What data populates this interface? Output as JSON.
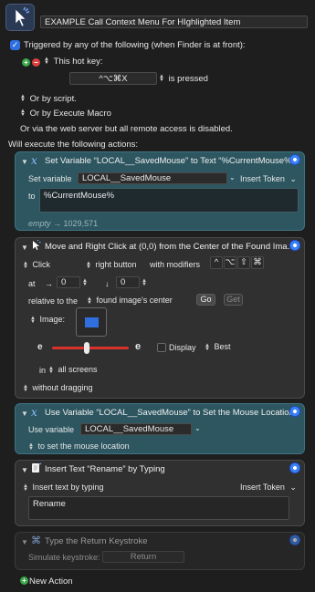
{
  "header": {
    "macro_name": "EXAMPLE Call Context Menu For HIghlighted Item"
  },
  "trigger": {
    "checkbox_label": "Triggered by any of the following (when Finder is at front):",
    "hotkey_label": "This hot key:",
    "hotkey_value": "^⌥⌘X",
    "hotkey_state": "is pressed",
    "or_by_script": "Or by script.",
    "or_by_execute_macro": "Or by Execute Macro",
    "web_server_note": "Or via the web server but all remote access is disabled."
  },
  "actions_header": "Will execute the following actions:",
  "action1": {
    "title": "Set Variable “LOCAL__SavedMouse” to Text “%CurrentMouse%”",
    "set_variable_label": "Set variable",
    "variable_name": "LOCAL__SavedMouse",
    "insert_token": "Insert Token",
    "to_label": "to",
    "text_value": "%CurrentMouse%",
    "result_empty": "empty",
    "result_value": "1029,571"
  },
  "action2": {
    "title": "Move and Right Click at (0,0) from the Center of the Found Ima...",
    "click_label": "Click",
    "button_label": "right button",
    "modifiers_label": "with modifiers",
    "modifier_keys": [
      "^",
      "⌥",
      "⇧",
      "⌘"
    ],
    "at_label": "at",
    "x_value": "0",
    "y_value": "0",
    "relative_label": "relative to the",
    "relative_value": "found image's center",
    "go_button": "Go",
    "get_button": "Get",
    "image_label": "Image:",
    "display_label": "Display",
    "best_label": "Best",
    "in_label": "in",
    "screens_value": "all screens",
    "dragging_value": "without dragging",
    "fuzziness_fraction": 0.5
  },
  "action3": {
    "title": "Use Variable “LOCAL__SavedMouse” to Set the Mouse Location",
    "use_variable_label": "Use variable",
    "variable_name": "LOCAL__SavedMouse",
    "purpose": "to set the mouse location"
  },
  "action4": {
    "title": "Insert Text “Rename” by Typing",
    "insert_mode": "Insert text by typing",
    "insert_token": "Insert Token",
    "text_value": "Rename"
  },
  "action5": {
    "title": "Type the Return Keystroke",
    "simulate_label": "Simulate keystroke:",
    "keystroke_value": "Return"
  },
  "footer": {
    "new_action": "New Action"
  },
  "colors": {
    "teal_action": "#2d5660",
    "accent_blue": "#2f6fe0",
    "slider_red": "#d9322b"
  }
}
